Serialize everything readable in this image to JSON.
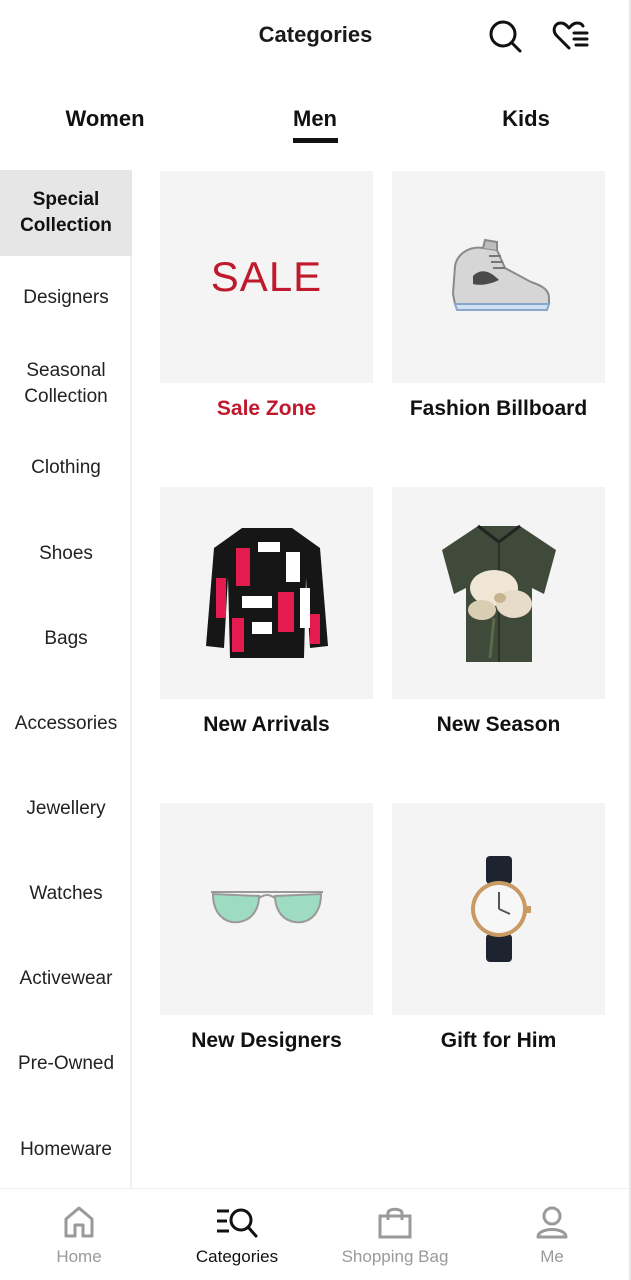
{
  "header": {
    "title": "Categories"
  },
  "gender_tabs": [
    {
      "label": "Women"
    },
    {
      "label": "Men",
      "selected": true
    },
    {
      "label": "Kids"
    }
  ],
  "sidebar": {
    "items": [
      {
        "label": "Special Collection",
        "active": true
      },
      {
        "label": "Designers"
      },
      {
        "label": "Seasonal Collection"
      },
      {
        "label": "Clothing"
      },
      {
        "label": "Shoes"
      },
      {
        "label": "Bags"
      },
      {
        "label": "Accessories"
      },
      {
        "label": "Jewellery"
      },
      {
        "label": "Watches"
      },
      {
        "label": "Activewear"
      },
      {
        "label": "Pre-Owned"
      },
      {
        "label": "Homeware"
      }
    ]
  },
  "tiles": [
    {
      "label": "Sale Zone",
      "image_text": "SALE",
      "icon": "sale-banner"
    },
    {
      "label": "Fashion Billboard",
      "icon": "sneaker-image"
    },
    {
      "label": "New Arrivals",
      "icon": "sweater-image"
    },
    {
      "label": "New Season",
      "icon": "floral-shirt-image"
    },
    {
      "label": "New Designers",
      "icon": "sunglasses-image"
    },
    {
      "label": "Gift for Him",
      "icon": "watch-image"
    }
  ],
  "bottom_nav": [
    {
      "label": "Home",
      "icon": "home-icon"
    },
    {
      "label": "Categories",
      "icon": "categories-search-icon",
      "active": true
    },
    {
      "label": "Shopping Bag",
      "icon": "shopping-bag-icon"
    },
    {
      "label": "Me",
      "icon": "user-icon"
    }
  ],
  "colors": {
    "sale_red": "#c0192e",
    "tile_bg": "#f4f4f4",
    "active_sidebar_bg": "#e6e6e6"
  }
}
